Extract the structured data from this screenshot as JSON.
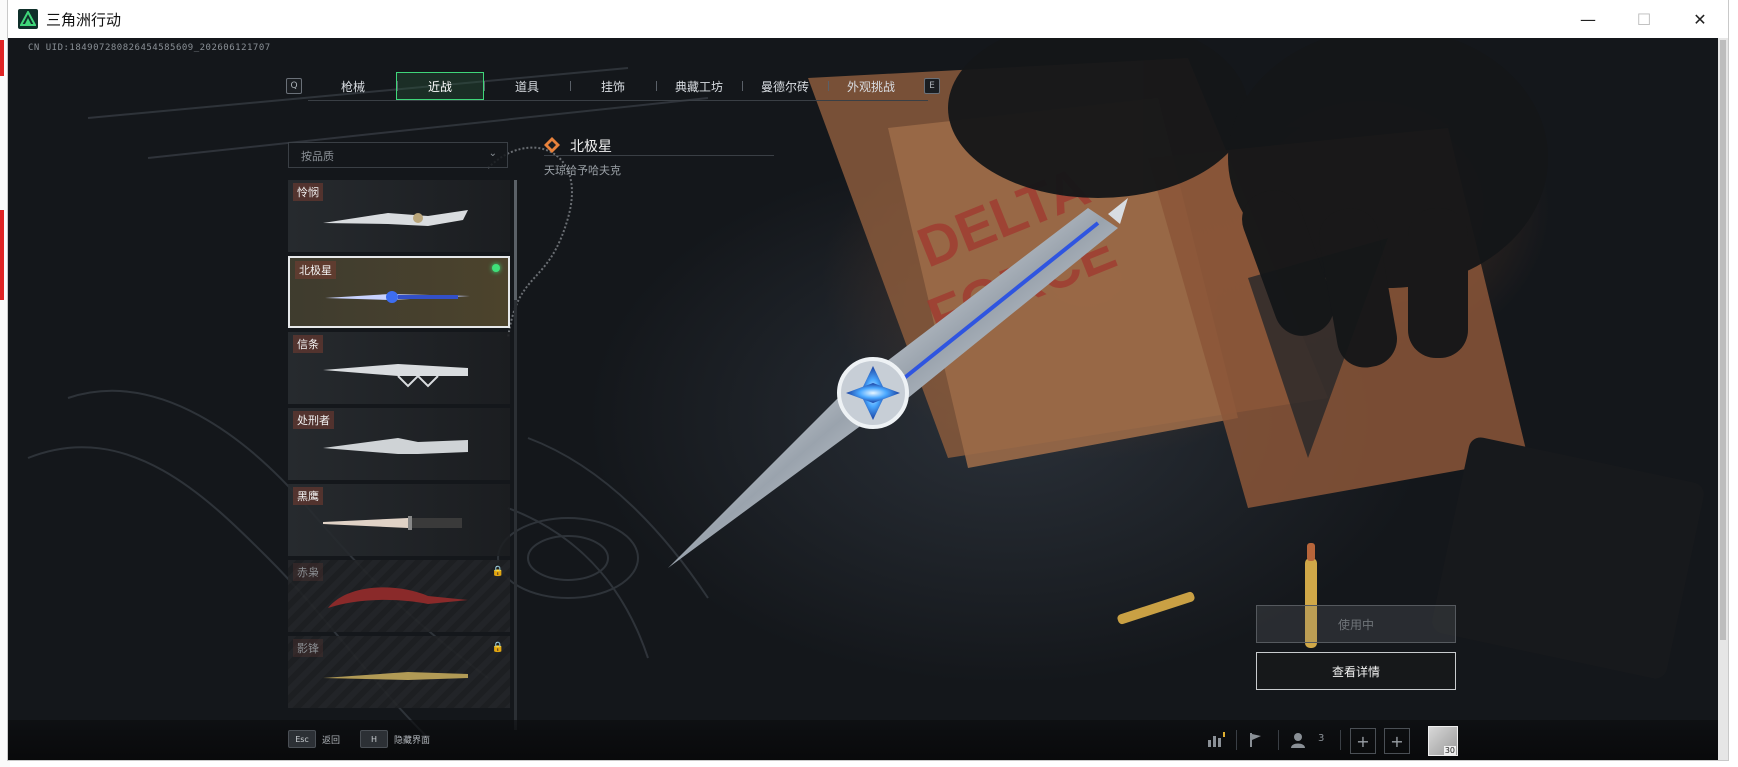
{
  "window": {
    "app_title": "三角洲行动",
    "minimize_symbol": "—",
    "maximize_symbol": "☐",
    "close_symbol": "✕"
  },
  "uid": "CN UID:1849072808264545856​09_20260612​1707",
  "tabs": {
    "prev_key": "Q",
    "next_key": "E",
    "items": [
      {
        "label": "枪械",
        "active": false
      },
      {
        "label": "近战",
        "active": true
      },
      {
        "label": "道具",
        "active": false
      },
      {
        "label": "挂饰",
        "active": false
      },
      {
        "label": "典藏工坊",
        "active": false
      },
      {
        "label": "曼德尔砖",
        "active": false
      },
      {
        "label": "外观挑战",
        "active": false
      }
    ]
  },
  "filter": {
    "label": "按品质",
    "chevron": "⌄"
  },
  "items": [
    {
      "name": "怜悯",
      "state": "unlocked",
      "blade_color": "#d9dcdf"
    },
    {
      "name": "北极星",
      "state": "selected",
      "equipped": true,
      "blade_color": "#c8d2ff"
    },
    {
      "name": "信条",
      "state": "unlocked",
      "blade_color": "#d9dcdf"
    },
    {
      "name": "处刑者",
      "state": "unlocked",
      "blade_color": "#cfd3d6"
    },
    {
      "name": "黑鹰",
      "state": "unlocked",
      "blade_color": "#e0d2c6"
    },
    {
      "name": "赤枭",
      "state": "locked",
      "blade_color": "#8a2a2a"
    },
    {
      "name": "影锋",
      "state": "locked",
      "blade_color": "#b19a55"
    }
  ],
  "lock_symbol": "🔒",
  "selected": {
    "name": "北极星",
    "subtitle": "天琼给予哈夫克"
  },
  "buttons": {
    "equipped": "使用中",
    "details": "查看详情"
  },
  "bottom": {
    "esc_key": "Esc",
    "esc_label": "返回",
    "hide_key": "H",
    "hide_label": "隐藏界面",
    "team_count": "3",
    "add_symbol": "+",
    "avatar_level": "30"
  },
  "colors": {
    "accent_green": "#3fd67a",
    "selected_border": "#e6e8ea",
    "background": "#0f1114"
  }
}
